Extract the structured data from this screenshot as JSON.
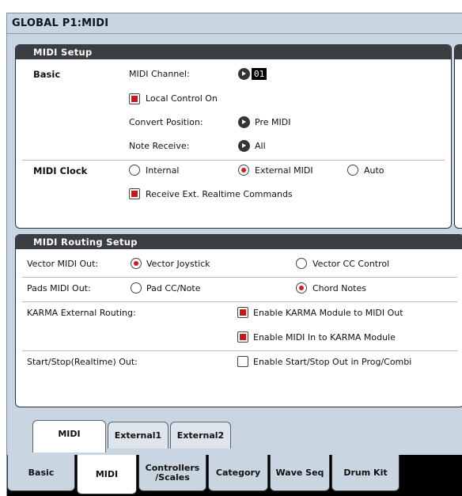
{
  "title": "GLOBAL P1:MIDI",
  "midi_setup": {
    "header": "MIDI Setup",
    "basic_label": "Basic",
    "midi_channel_label": "MIDI Channel:",
    "midi_channel_value": "01",
    "local_control_label": "Local Control On",
    "local_control_checked": true,
    "convert_position_label": "Convert Position:",
    "convert_position_value": "Pre MIDI",
    "note_receive_label": "Note Receive:",
    "note_receive_value": "All",
    "midi_clock_label": "MIDI Clock",
    "clock_options": [
      "Internal",
      "External MIDI",
      "Auto"
    ],
    "clock_selected": "External MIDI",
    "receive_ext_label": "Receive Ext. Realtime Commands",
    "receive_ext_checked": true
  },
  "midi_routing": {
    "header": "MIDI Routing Setup",
    "vector_label": "Vector MIDI Out:",
    "vector_options": [
      "Vector Joystick",
      "Vector CC Control"
    ],
    "vector_selected": "Vector Joystick",
    "pads_label": "Pads MIDI Out:",
    "pads_options": [
      "Pad CC/Note",
      "Chord Notes"
    ],
    "pads_selected": "Chord Notes",
    "karma_label": "KARMA External Routing:",
    "karma_module_to_midi_label": "Enable KARMA Module to MIDI Out",
    "karma_module_to_midi_checked": true,
    "karma_midi_in_label": "Enable MIDI In to KARMA Module",
    "karma_midi_in_checked": true,
    "start_stop_label": "Start/Stop(Realtime) Out:",
    "start_stop_enable_label": "Enable Start/Stop Out in Prog/Combi",
    "start_stop_checked": false
  },
  "sub_tabs": [
    "MIDI",
    "External1",
    "External2"
  ],
  "sub_tab_active": "MIDI",
  "page_tabs": [
    "Basic",
    "MIDI",
    "Controllers /Scales",
    "Category",
    "Wave Seq",
    "Drum Kit"
  ],
  "page_tab_active": "MIDI"
}
